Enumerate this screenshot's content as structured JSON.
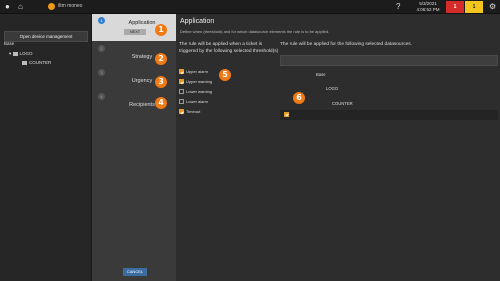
{
  "topbar": {
    "app_name": "iltm moneo",
    "date": "5/3/2021",
    "time": "4:06:52 PM",
    "alarm_red_count": "1",
    "alarm_yellow_count": "1",
    "colors": {
      "red": "#d42b2b",
      "yellow": "#f2c61f",
      "brand": "#f09a1a"
    }
  },
  "left": {
    "open_button": "Open device management",
    "tree": [
      {
        "label": "Base"
      },
      {
        "label": "LOGO"
      },
      {
        "label": "COUNTER"
      }
    ]
  },
  "steps": [
    {
      "label": "Application",
      "next": "NEXT",
      "number": "1",
      "active": true
    },
    {
      "label": "Strategy",
      "number": "2",
      "active": false
    },
    {
      "label": "Urgency",
      "number": "3",
      "active": false
    },
    {
      "label": "Recipients",
      "number": "4",
      "active": false
    }
  ],
  "cancel_label": "CANCEL",
  "callouts": [
    "1",
    "2",
    "3",
    "4",
    "5",
    "6"
  ],
  "main": {
    "title": "Application",
    "description": "Define when (threshold) and for which datasource elements the rule is to be applied.",
    "threshold_heading": "The rule will be applied when a ticket is triggered by the following selected threshold(s)",
    "thresholds": [
      {
        "label": "Upper alarm",
        "checked": true
      },
      {
        "label": "Upper warning",
        "checked": true
      },
      {
        "label": "Lower warning",
        "checked": false
      },
      {
        "label": "Lower alarm",
        "checked": false
      },
      {
        "label": "Timeout",
        "checked": true
      }
    ],
    "datasource_heading": "The rule will be applied for the following selected datasources.",
    "search_value": "",
    "datasources": [
      {
        "label": "Base",
        "checked": false
      },
      {
        "label": "LOGO",
        "checked": false
      },
      {
        "label": "COUNTER",
        "checked": true
      }
    ]
  }
}
